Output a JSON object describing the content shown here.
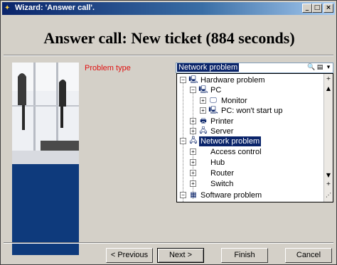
{
  "window": {
    "title": "Wizard: 'Answer call'.",
    "minimize_label": "_",
    "maximize_label": "□",
    "close_label": "×"
  },
  "heading": "Answer call: New ticket (884 seconds)",
  "form": {
    "problem_type_label": "Problem type",
    "problem_type_value": "Network problem"
  },
  "tree": {
    "items": [
      {
        "label": "Hardware problem",
        "expander": "−",
        "icon": "computer-icon"
      },
      {
        "label": "PC",
        "expander": "−",
        "icon": "computer-icon"
      },
      {
        "label": "Monitor",
        "expander": "+",
        "icon": "monitor-icon"
      },
      {
        "label": "PC: won't start up",
        "expander": "+",
        "icon": "computer-icon"
      },
      {
        "label": "Printer",
        "expander": "+",
        "icon": "printer-icon"
      },
      {
        "label": "Server",
        "expander": "+",
        "icon": "server-icon"
      },
      {
        "label": "Network problem",
        "expander": "−",
        "icon": "network-icon"
      },
      {
        "label": "Access control",
        "expander": "+",
        "icon": ""
      },
      {
        "label": "Hub",
        "expander": "+",
        "icon": ""
      },
      {
        "label": "Router",
        "expander": "+",
        "icon": ""
      },
      {
        "label": "Switch",
        "expander": "+",
        "icon": ""
      },
      {
        "label": "Software problem",
        "expander": "−",
        "icon": "software-icon"
      }
    ]
  },
  "buttons": {
    "previous": "< Previous",
    "next": "Next >",
    "finish": "Finish",
    "cancel": "Cancel"
  },
  "colors": {
    "title_bar": "#0a246a",
    "selection": "#0a246a",
    "label_red": "#e01010",
    "panel_blue": "#0e3a7c"
  }
}
